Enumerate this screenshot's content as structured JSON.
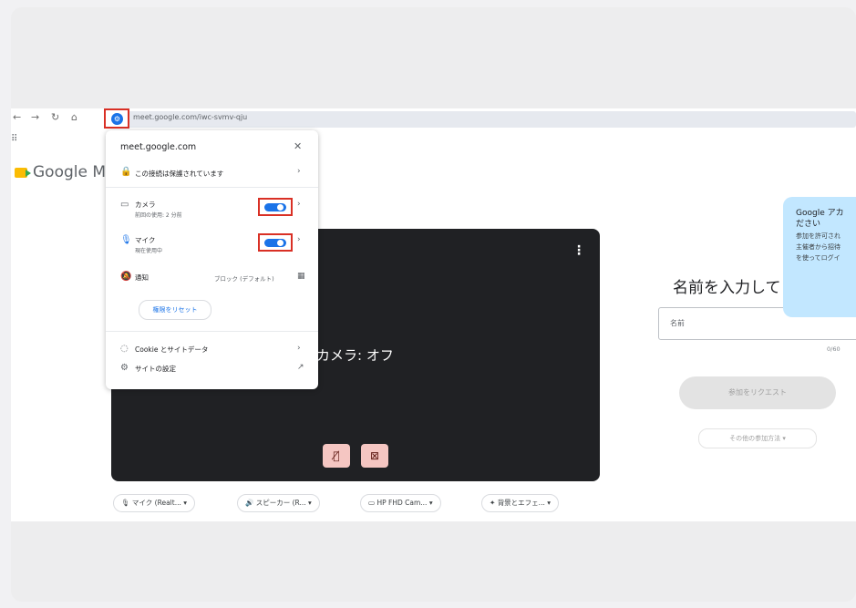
{
  "browser": {
    "url": "meet.google.com/iwc-svmv-qju"
  },
  "meet": {
    "logo": "Google M",
    "camera_off_text": "カメラ: オフ",
    "devices": {
      "mic": "マイク (Realt...",
      "speaker": "スピーカー (R...",
      "camera": "HP FHD Cam...",
      "effects": "背景とエフェ..."
    },
    "join": {
      "title": "名前を入力して",
      "name_placeholder": "名前",
      "counter": "0/60",
      "ask_button": "参加をリクエスト",
      "other_ways": "その他の参加方法"
    },
    "tooltip": {
      "line1": "Google アカ",
      "line2": "ださい",
      "line3": "参加を許可され",
      "line4": "主催者から招待",
      "line5": "を使ってログイ"
    }
  },
  "site_info": {
    "domain": "meet.google.com",
    "secure": "この接続は保護されています",
    "camera": {
      "label": "カメラ",
      "sub": "前回の使用: 2 分前",
      "enabled": true
    },
    "mic": {
      "label": "マイク",
      "sub": "現在使用中",
      "enabled": true
    },
    "notifications": {
      "label": "通知",
      "state": "ブロック (デフォルト)"
    },
    "reset_button": "権限をリセット",
    "cookies": "Cookie とサイトデータ",
    "site_settings": "サイトの設定"
  },
  "colors": {
    "highlight": "#d93025",
    "toggle_on": "#1a73e8",
    "tooltip_bg": "#c2e7ff",
    "video_bg": "#202124"
  }
}
